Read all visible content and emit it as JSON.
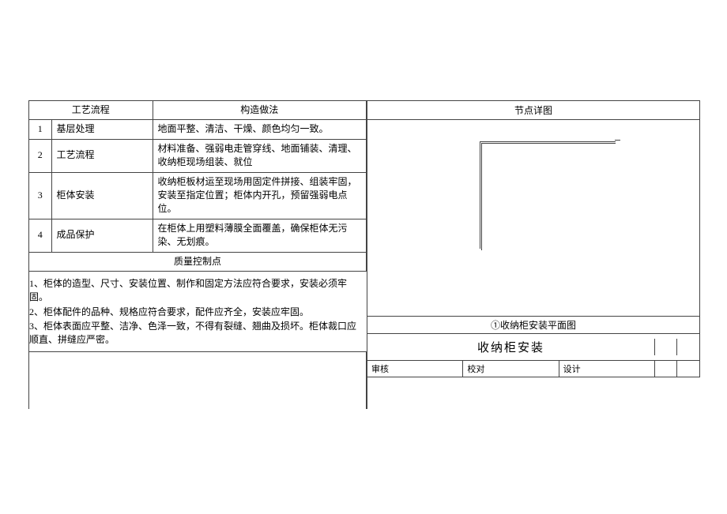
{
  "headers": {
    "process": "工艺流程",
    "method": "构造做法",
    "detail": "节点详图"
  },
  "rows": [
    {
      "n": "1",
      "step": "基层处理",
      "desc": "地面平整、清洁、干燥、颜色均匀一致。"
    },
    {
      "n": "2",
      "step": "工艺流程",
      "desc": "材料准备、强弱电走管穿线、地面铺装、清理、收纳柜现场组装、就位"
    },
    {
      "n": "3",
      "step": "柜体安装",
      "desc": "收纳柜板材运至现场用固定件拼接、组装牢固，安装至指定位置；柜体内开孔，预留强弱电点位。"
    },
    {
      "n": "4",
      "step": "成品保护",
      "desc": "在柜体上用塑料薄膜全面覆盖，确保柜体无污染、无划痕。"
    }
  ],
  "qcp": {
    "header": "质量控制点"
  },
  "notes": [
    "1、柜体的造型、尺寸、安装位置、制作和固定方法应符合要求，安装必须牢固。",
    "2、柜体配件的品种、规格应符合要求，配件应齐全，安装应牢固。",
    "3、柜体表面应平整、洁净、色泽一致，不得有裂缝、翘曲及损坏。柜体裁口应顺直、拼缝应严密。"
  ],
  "diagram_caption": "①收纳柜安装平面图",
  "title": "收纳柜安装",
  "sig": {
    "a": "审核",
    "b": "校对",
    "c": "设计"
  }
}
